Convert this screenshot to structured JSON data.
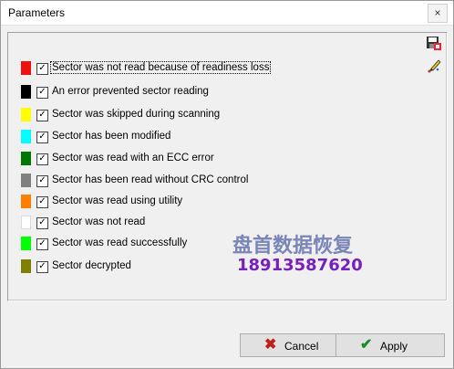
{
  "window": {
    "title": "Parameters",
    "close_glyph": "×"
  },
  "toolbar": {
    "icons": [
      "save-disk-icon",
      "edit-brush-icon"
    ]
  },
  "legend": [
    {
      "color": "#ee1111",
      "checked": true,
      "label": "Sector was not read because of readiness loss"
    },
    {
      "color": "#000000",
      "checked": true,
      "label": "An error prevented sector reading"
    },
    {
      "color": "#ffff00",
      "checked": true,
      "label": "Sector was skipped during scanning"
    },
    {
      "color": "#00ffff",
      "checked": true,
      "label": "Sector has been modified"
    },
    {
      "color": "#007700",
      "checked": true,
      "label": "Sector was read with an ECC error"
    },
    {
      "color": "#808080",
      "checked": true,
      "label": "Sector has been read without CRC control"
    },
    {
      "color": "#ff7f00",
      "checked": true,
      "label": "Sector was read using utility"
    },
    {
      "color": "#ffffff",
      "checked": true,
      "label": "Sector was not read"
    },
    {
      "color": "#00ff00",
      "checked": true,
      "label": "Sector was read successfully"
    },
    {
      "color": "#808000",
      "checked": true,
      "label": "Sector decrypted"
    }
  ],
  "check_glyph": "✓",
  "watermark": {
    "line1": "盘首数据恢复",
    "line2": "18913587620",
    "color1": "#7a86b8",
    "color2": "#7a1fbf"
  },
  "buttons": {
    "cancel": {
      "label": "Cancel",
      "icon": "✖",
      "color": "#c0201a"
    },
    "apply": {
      "label": "Apply",
      "icon": "✔",
      "color": "#1a8a2a"
    }
  }
}
